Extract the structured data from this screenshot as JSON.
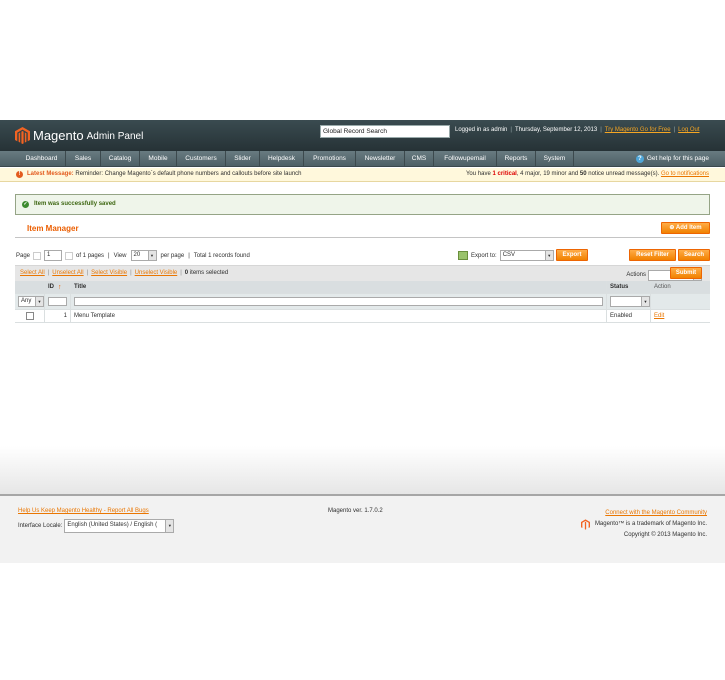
{
  "header": {
    "logo_text": "Magento",
    "logo_sub": "Admin Panel",
    "search_value": "Global Record Search",
    "logged_in": "Logged in as admin",
    "date": "Thursday, September 12, 2013",
    "try_link": "Try Magento Go for Free",
    "logout": "Log Out"
  },
  "nav": {
    "items": [
      "Dashboard",
      "Sales",
      "Catalog",
      "Mobile",
      "Customers",
      "Slider",
      "Helpdesk",
      "Promotions",
      "Newsletter",
      "CMS",
      "Followupemail",
      "Reports",
      "System"
    ],
    "help": "Get help for this page"
  },
  "notice": {
    "label": "Latest Message:",
    "text": "Reminder: Change Magento`s default phone numbers and callouts before site launch",
    "right_prefix": "You have",
    "critical_count": "1",
    "critical_word": "critical",
    "major": ", 4 major, ",
    "minor": "19 minor and ",
    "notice_count": "50",
    "right_suffix": "notice unread message(s).",
    "link": "Go to notifications"
  },
  "success": {
    "text": "Item was successfully saved"
  },
  "page": {
    "title": "Item Manager",
    "add_button": "Add Item"
  },
  "pager": {
    "page_label": "Page",
    "page_value": "1",
    "of_pages": "of 1 pages",
    "view_label": "View",
    "per_page_value": "20",
    "per_page_label": "per page",
    "total": "Total 1 records found"
  },
  "export": {
    "label": "Export to:",
    "format": "CSV",
    "button": "Export",
    "reset": "Reset Filter",
    "search": "Search"
  },
  "massaction": {
    "select_all": "Select All",
    "unselect_all": "Unselect All",
    "select_visible": "Select Visible",
    "unselect_visible": "Unselect Visible",
    "count": "0",
    "count_label": "items selected",
    "actions_label": "Actions",
    "submit": "Submit"
  },
  "grid": {
    "columns": {
      "id": "ID",
      "title": "Title",
      "status": "Status",
      "action": "Action"
    },
    "filter_any": "Any",
    "rows": [
      {
        "id": "1",
        "title": "Menu Template",
        "status": "Enabled",
        "action": "Edit"
      }
    ]
  },
  "footer": {
    "help_link": "Help Us Keep Magento Healthy - Report All Bugs",
    "locale_label": "Interface Locale:",
    "locale_value": "English (United States) / English (",
    "version": "Magento ver. 1.7.0.2",
    "community_link": "Connect with the Magento Community",
    "trademark": "Magento™ is a trademark of Magento Inc.",
    "copyright": "Copyright © 2013 Magento Inc."
  },
  "colors": {
    "accent": "#eb5e00",
    "header": "#2c3a3e",
    "nav": "#5b6d73",
    "link": "#ea7601"
  }
}
